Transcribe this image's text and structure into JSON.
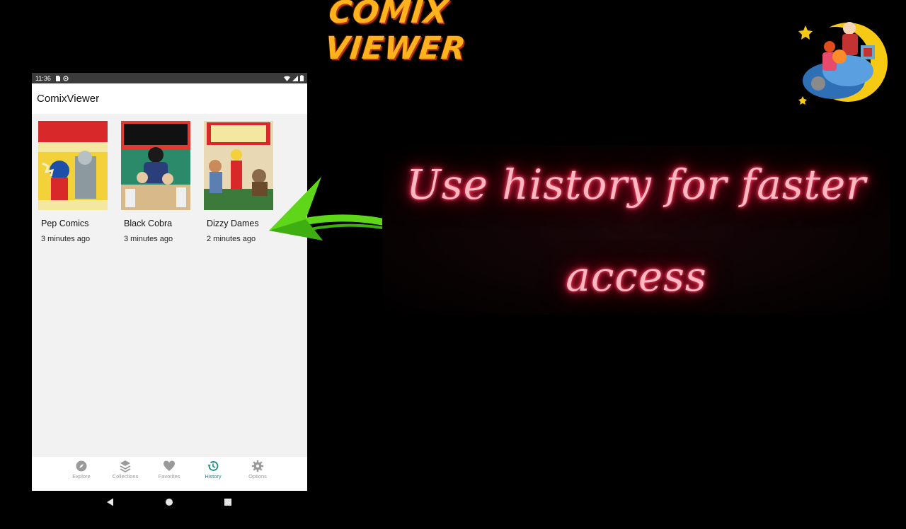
{
  "logo": {
    "text": "COMIX VIEWER"
  },
  "caption": {
    "line1": "Use history for faster",
    "line2": "access"
  },
  "status_bar": {
    "time": "11:36"
  },
  "app_bar": {
    "title": "ComixViewer"
  },
  "history": [
    {
      "title": "Pep Comics",
      "time": "3 minutes ago"
    },
    {
      "title": "Black Cobra",
      "time": "3 minutes ago"
    },
    {
      "title": "Dizzy Dames",
      "time": "2 minutes ago"
    }
  ],
  "bottom_nav": {
    "items": [
      {
        "label": "Explore",
        "icon": "compass-icon"
      },
      {
        "label": "Collections",
        "icon": "layers-icon"
      },
      {
        "label": "Favorites",
        "icon": "heart-icon"
      },
      {
        "label": "History",
        "icon": "history-icon"
      },
      {
        "label": "Options",
        "icon": "gear-icon"
      }
    ],
    "active": "History"
  },
  "colors": {
    "accent": "#1a8f80",
    "neon": "#ff2d55",
    "arrow": "#5fd61a",
    "logo": "#ffb21c"
  }
}
